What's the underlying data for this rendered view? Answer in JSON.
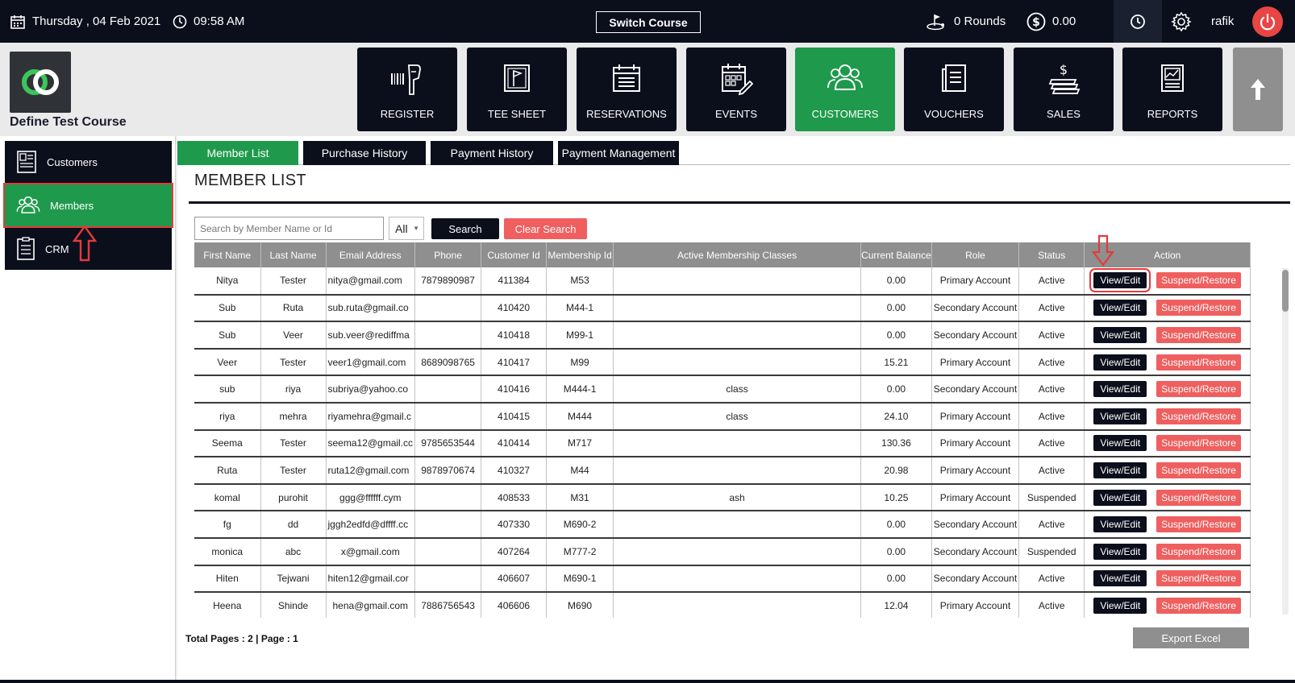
{
  "topbar": {
    "date": "Thursday , 04 Feb 2021",
    "time": "09:58 AM",
    "switch_course": "Switch Course",
    "rounds": "0 Rounds",
    "balance": "0.00",
    "user": "rafik"
  },
  "header": {
    "course_name": "Define Test Course",
    "nav": [
      {
        "label": "REGISTER",
        "icon": "barcode-scanner-icon"
      },
      {
        "label": "TEE SHEET",
        "icon": "flag-icon"
      },
      {
        "label": "RESERVATIONS",
        "icon": "calendar-list-icon"
      },
      {
        "label": "EVENTS",
        "icon": "calendar-edit-icon"
      },
      {
        "label": "CUSTOMERS",
        "icon": "users-icon",
        "active": true
      },
      {
        "label": "VOUCHERS",
        "icon": "document-icon"
      },
      {
        "label": "SALES",
        "icon": "dollar-stack-icon"
      },
      {
        "label": "REPORTS",
        "icon": "report-chart-icon"
      }
    ]
  },
  "sidebar": {
    "items": [
      {
        "label": "Customers",
        "icon": "customer-card-icon"
      },
      {
        "label": "Members",
        "icon": "users-icon",
        "active": true
      },
      {
        "label": "CRM",
        "icon": "checklist-icon"
      }
    ]
  },
  "tabs": [
    {
      "label": "Member List",
      "active": true
    },
    {
      "label": "Purchase History"
    },
    {
      "label": "Payment History"
    },
    {
      "label": "Payment Management"
    }
  ],
  "page_title": "MEMBER LIST",
  "search": {
    "placeholder": "Search by Member Name or Id",
    "filter_value": "All",
    "search_label": "Search",
    "clear_label": "Clear Search"
  },
  "table": {
    "columns": [
      "First Name",
      "Last Name",
      "Email Address",
      "Phone",
      "Customer Id",
      "Membership Id",
      "Active Membership Classes",
      "Current Balance",
      "Role",
      "Status",
      "Action"
    ],
    "view_label": "View/Edit",
    "suspend_label": "Suspend/Restore",
    "rows": [
      [
        "Nitya",
        "Tester",
        "nitya@gmail.com",
        "7879890987",
        "411384",
        "M53",
        "",
        "0.00",
        "Primary Account",
        "Active"
      ],
      [
        "Sub",
        "Ruta",
        "sub.ruta@gmail.co",
        "",
        "410420",
        "M44-1",
        "",
        "0.00",
        "Secondary Account",
        "Active"
      ],
      [
        "Sub",
        "Veer",
        "sub.veer@rediffma",
        "",
        "410418",
        "M99-1",
        "",
        "0.00",
        "Secondary Account",
        "Active"
      ],
      [
        "Veer",
        "Tester",
        "veer1@gmail.com",
        "8689098765",
        "410417",
        "M99",
        "",
        "15.21",
        "Primary Account",
        "Active"
      ],
      [
        "sub",
        "riya",
        "subriya@yahoo.co",
        "",
        "410416",
        "M444-1",
        "class",
        "0.00",
        "Secondary Account",
        "Active"
      ],
      [
        "riya",
        "mehra",
        "riyamehra@gmail.c",
        "",
        "410415",
        "M444",
        "class",
        "24.10",
        "Primary Account",
        "Active"
      ],
      [
        "Seema",
        "Tester",
        "seema12@gmail.cc",
        "9785653544",
        "410414",
        "M717",
        "",
        "130.36",
        "Primary Account",
        "Active"
      ],
      [
        "Ruta",
        "Tester",
        "ruta12@gmail.com",
        "9878970674",
        "410327",
        "M44",
        "",
        "20.98",
        "Primary Account",
        "Active"
      ],
      [
        "komal",
        "purohit",
        "ggg@ffffff.cym",
        "",
        "408533",
        "M31",
        "ash",
        "10.25",
        "Primary Account",
        "Suspended"
      ],
      [
        "fg",
        "dd",
        "jggh2edfd@dffff.cc",
        "",
        "407330",
        "M690-2",
        "",
        "0.00",
        "Secondary Account",
        "Active"
      ],
      [
        "monica",
        "abc",
        "x@gmail.com",
        "",
        "407264",
        "M777-2",
        "",
        "0.00",
        "Secondary Account",
        "Suspended"
      ],
      [
        "Hiten",
        "Tejwani",
        "hiten12@gmail.cor",
        "",
        "406607",
        "M690-1",
        "",
        "0.00",
        "Secondary Account",
        "Active"
      ],
      [
        "Heena",
        "Shinde",
        "hena@gmail.com",
        "7886756543",
        "406606",
        "M690",
        "",
        "12.04",
        "Primary Account",
        "Active"
      ]
    ]
  },
  "pagination": "Total Pages : 2 | Page : 1",
  "export_label": "Export Excel"
}
